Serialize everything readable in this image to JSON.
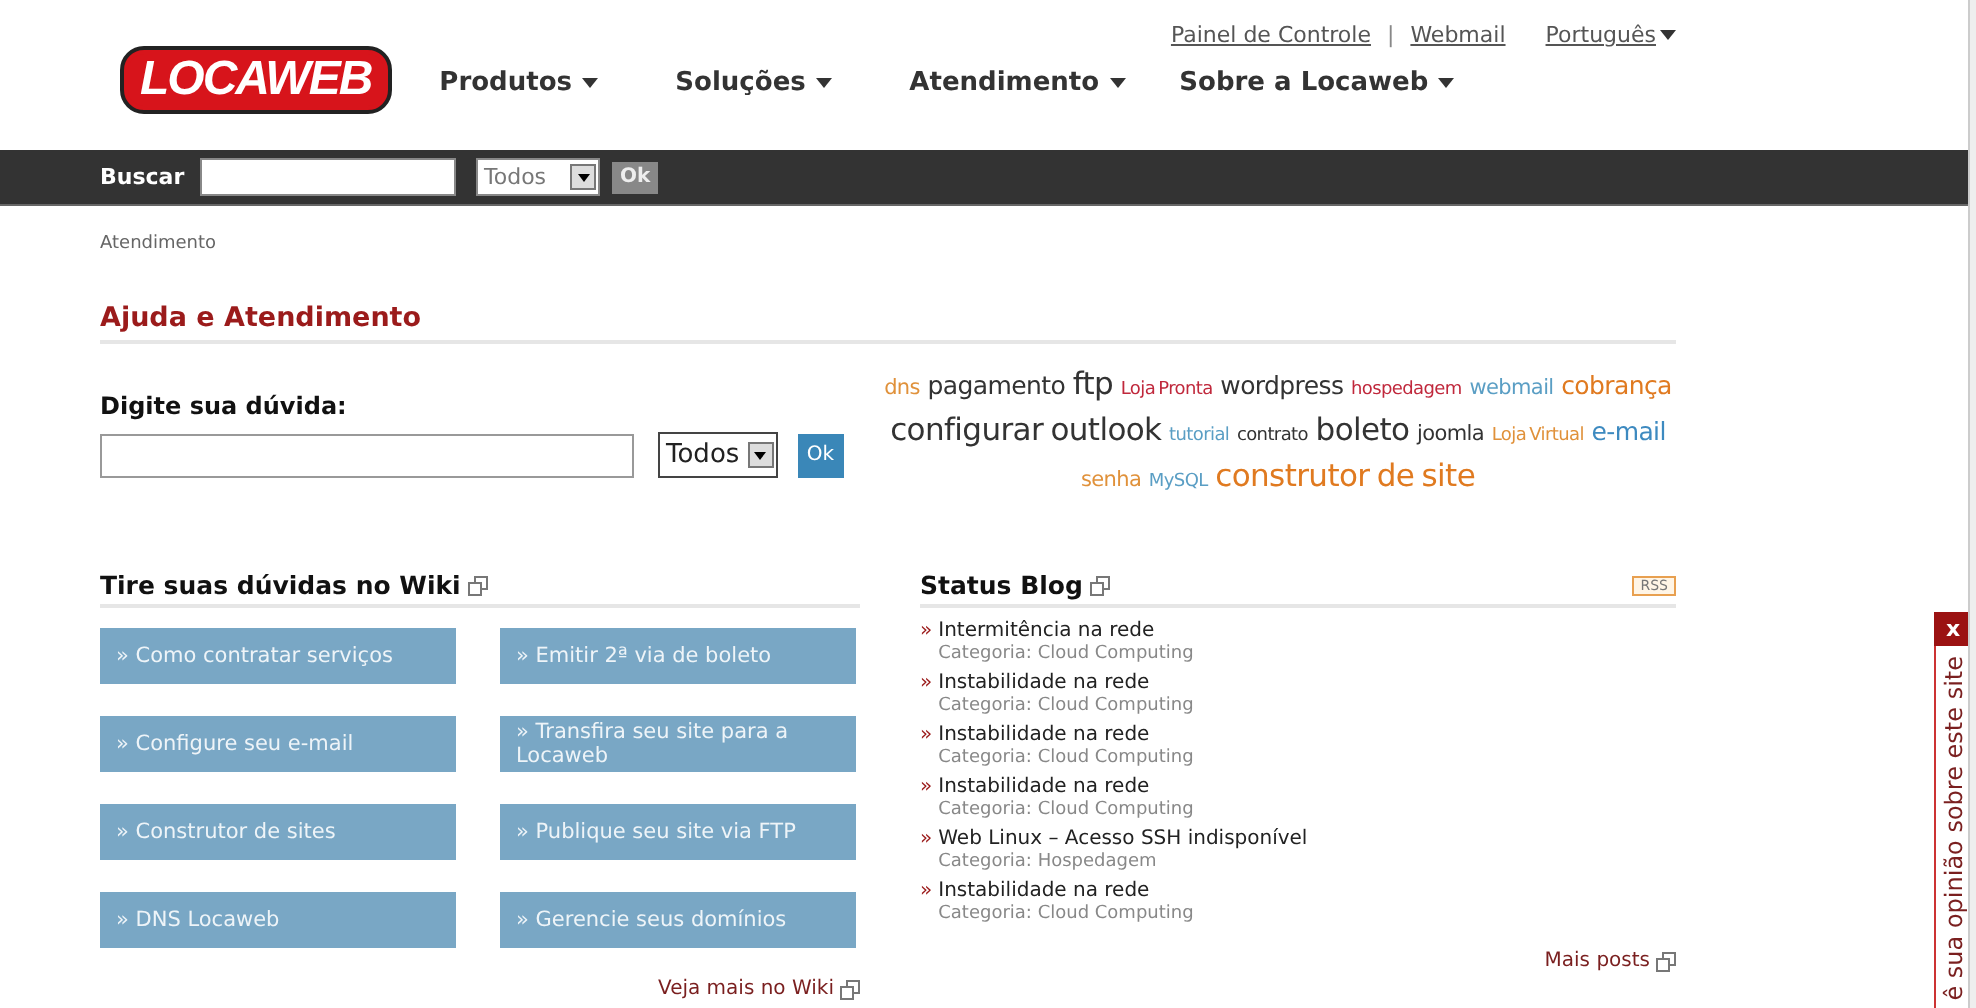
{
  "header": {
    "logo": "LOCAWEB",
    "top_links": [
      {
        "label": "Painel de Controle",
        "kind": "link"
      },
      {
        "label": "|",
        "kind": "sep"
      },
      {
        "label": "Webmail",
        "kind": "link"
      },
      {
        "label": "Português",
        "kind": "menu"
      }
    ],
    "nav": [
      "Produtos",
      "Soluções",
      "Atendimento",
      "Sobre a Locaweb"
    ]
  },
  "search_bar": {
    "label": "Buscar",
    "scope": "Todos",
    "button": "Ok"
  },
  "breadcrumb": "Atendimento",
  "title": "Ajuda e Atendimento",
  "question": {
    "label": "Digite sua dúvida:",
    "scope": "Todos",
    "button": "Ok"
  },
  "tag_cloud": [
    {
      "text": "dns",
      "kind": "m",
      "color": "#e0913a"
    },
    {
      "text": "pagamento",
      "kind": "l",
      "color": "#333333"
    },
    {
      "text": "ftp",
      "kind": "xl",
      "color": "#333333"
    },
    {
      "text": "Loja Pronta",
      "kind": "s",
      "color": "#c0283c"
    },
    {
      "text": "wordpress",
      "kind": "l",
      "color": "#333333"
    },
    {
      "text": "hospedagem",
      "kind": "s",
      "color": "#c0283c"
    },
    {
      "text": "webmail",
      "kind": "m",
      "color": "#5a9ec4"
    },
    {
      "text": "cobrança",
      "kind": "l",
      "color": "#e07a20"
    },
    {
      "text": "configurar outlook",
      "kind": "xl",
      "color": "#333333"
    },
    {
      "text": "tutorial",
      "kind": "s",
      "color": "#5a9ec4"
    },
    {
      "text": "contrato",
      "kind": "s",
      "color": "#333333"
    },
    {
      "text": "boleto",
      "kind": "xl",
      "color": "#333333"
    },
    {
      "text": "joomla",
      "kind": "m",
      "color": "#333333"
    },
    {
      "text": "Loja Virtual",
      "kind": "s",
      "color": "#e0913a"
    },
    {
      "text": "e-mail",
      "kind": "l",
      "color": "#3d8ac0"
    },
    {
      "text": "senha",
      "kind": "m",
      "color": "#e0913a"
    },
    {
      "text": "MySQL",
      "kind": "s",
      "color": "#5a9ec4"
    },
    {
      "text": "construtor de site",
      "kind": "xl",
      "color": "#e07a20"
    }
  ],
  "wiki": {
    "title": "Tire suas dúvidas no Wiki",
    "links": [
      "» Como contratar serviços",
      "» Emitir 2ª via de boleto",
      "» Configure seu e-mail",
      "» Transfira seu site para a Locaweb",
      "» Construtor de sites",
      "» Publique seu site via FTP",
      "» DNS Locaweb",
      "» Gerencie seus domínios"
    ],
    "more": "Veja mais no Wiki"
  },
  "blog": {
    "title": "Status Blog",
    "rss": "RSS",
    "posts": [
      {
        "marker": "»",
        "title": "Intermitência na rede",
        "category": "Categoria: Cloud Computing"
      },
      {
        "marker": "»",
        "title": "Instabilidade na rede",
        "category": "Categoria: Cloud Computing"
      },
      {
        "marker": "»",
        "title": "Instabilidade na rede",
        "category": "Categoria: Cloud Computing"
      },
      {
        "marker": "»",
        "title": "Instabilidade na rede",
        "category": "Categoria: Cloud Computing"
      },
      {
        "marker": "»",
        "title": "Web Linux – Acesso SSH indisponível",
        "category": "Categoria: Hospedagem"
      },
      {
        "marker": "»",
        "title": "Instabilidade na rede",
        "category": "Categoria: Cloud Computing"
      }
    ],
    "more": "Mais posts"
  },
  "feedback": {
    "close": "x",
    "label": "ê sua opinião sobre este site"
  }
}
